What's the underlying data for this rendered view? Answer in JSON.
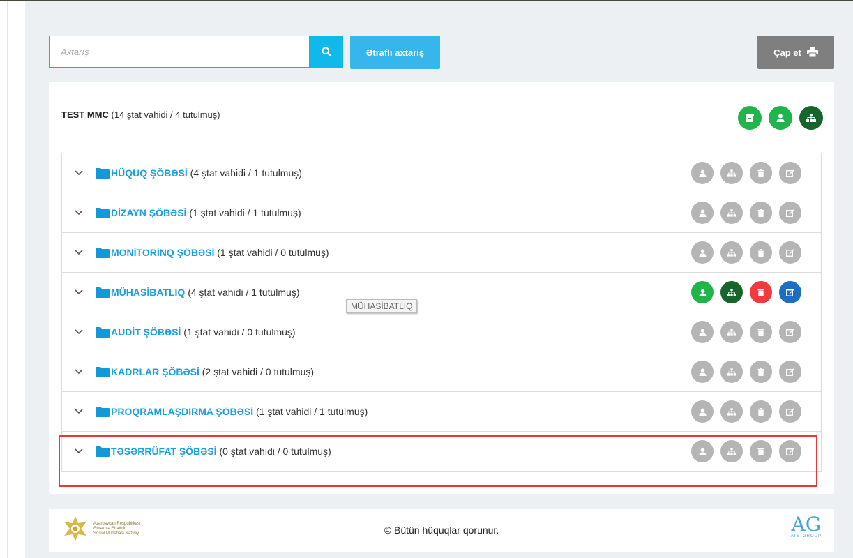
{
  "search": {
    "placeholder": "Axtarış"
  },
  "buttons": {
    "advanced_search": "Ətraflı axtarış",
    "print": "Çap et"
  },
  "org": {
    "name": "TEST MMC",
    "counts": "(14 ştat vahidi / 4 tutulmuş)"
  },
  "departments": [
    {
      "name": "HÜQUQ ŞÖBƏSİ",
      "counts": "(4 ştat vahidi / 1 tutulmuş)"
    },
    {
      "name": "DİZAYN ŞÖBƏSİ",
      "counts": "(1 ştat vahidi / 1 tutulmuş)"
    },
    {
      "name": "MONİTORİNQ ŞÖBƏSİ",
      "counts": "(1 ştat vahidi / 0 tutulmuş)"
    },
    {
      "name": "MÜHASİBATLIQ",
      "counts": "(4 ştat vahidi / 1 tutulmuş)"
    },
    {
      "name": "AUDİT ŞÖBƏSİ",
      "counts": "(1 ştat vahidi / 0 tutulmuş)"
    },
    {
      "name": "KADRLAR ŞÖBƏSİ",
      "counts": "(2 ştat vahidi / 0 tutulmuş)"
    },
    {
      "name": "PROQRAMLAŞDIRMA ŞÖBƏSİ",
      "counts": "(1 ştat vahidi / 1 tutulmuş)"
    },
    {
      "name": "TƏSƏRRÜFAT ŞÖBƏSİ",
      "counts": "(0 ştat vahidi / 0 tutulmuş)"
    }
  ],
  "tooltip": "MÜHASİBATLIQ",
  "footer": {
    "copyright": "© Bütün hüquqlar qorunur.",
    "left_logo_lines": [
      "Azərbaycan Respublikası",
      "Əmək və Əhalinin",
      "Sosial Müdafiəsi Nazirliyi"
    ],
    "right_logo": {
      "mark": "AG",
      "sub": "AISTGROUP"
    }
  },
  "colors": {
    "accent": "#11b8ea",
    "green": "#1fb54b",
    "dark_green": "#16652b",
    "red": "#ef3b3b",
    "blue": "#1b6ec2",
    "gray_icon": "#b5b5b5",
    "highlight": "#e63939"
  },
  "icons": {
    "search": "search-icon",
    "print": "printer-icon",
    "archive": "archive-icon",
    "user": "user-icon",
    "hierarchy": "sitemap-icon",
    "trash": "trash-icon",
    "edit": "edit-icon",
    "folder": "folder-icon",
    "chevron": "chevron-down-icon"
  }
}
